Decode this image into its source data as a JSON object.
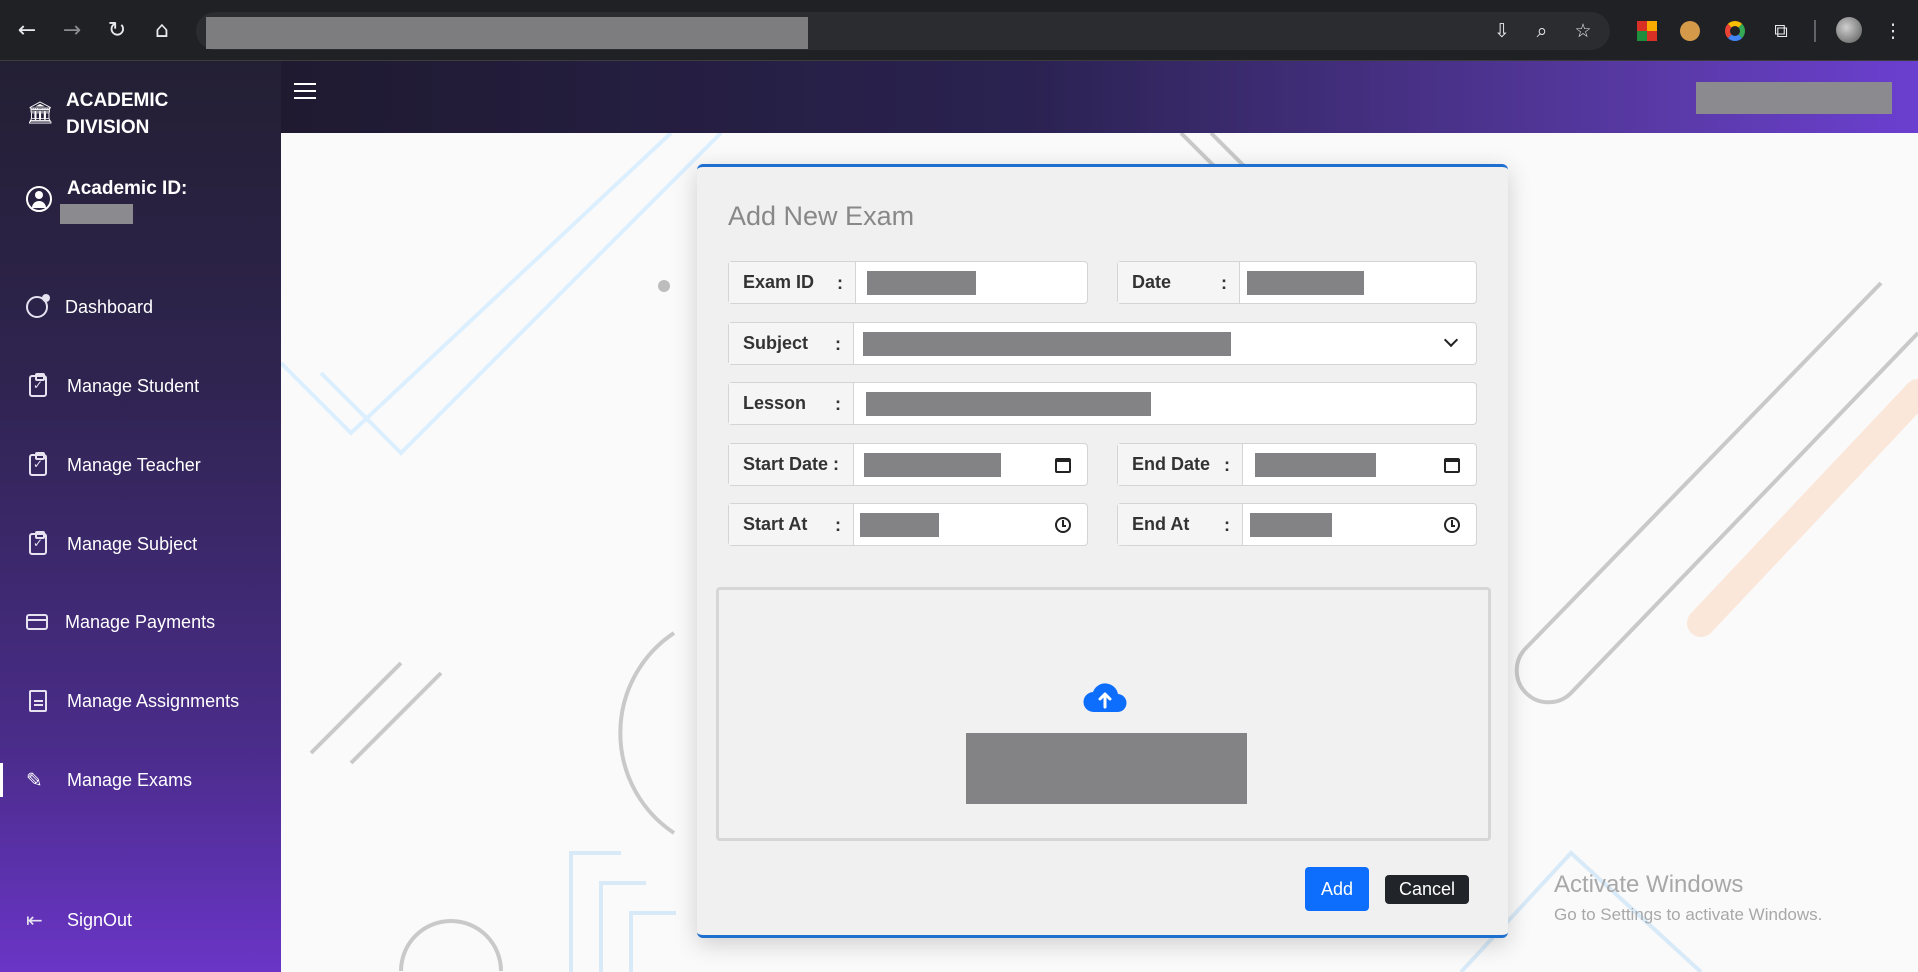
{
  "browser": {
    "icons": [
      "back-icon",
      "forward-icon",
      "reload-icon",
      "home-icon",
      "install-icon",
      "zoom-icon",
      "bookmark-star-icon",
      "extensions-icon",
      "profile-avatar",
      "more-menu-icon"
    ]
  },
  "sidebar": {
    "brand": "ACADEMIC DIVISION",
    "academic_id_label": "Academic ID:",
    "items": [
      {
        "label": "Dashboard",
        "icon": "dashboard-icon"
      },
      {
        "label": "Manage Student",
        "icon": "clipboard-check-icon"
      },
      {
        "label": "Manage Teacher",
        "icon": "clipboard-check-icon"
      },
      {
        "label": "Manage Subject",
        "icon": "clipboard-check-icon"
      },
      {
        "label": "Manage Payments",
        "icon": "credit-card-icon"
      },
      {
        "label": "Manage Assignments",
        "icon": "document-icon"
      },
      {
        "label": "Manage Exams",
        "icon": "edit-icon",
        "active": true
      }
    ],
    "signout": "SignOut"
  },
  "modal": {
    "title": "Add New Exam",
    "fields": {
      "exam_id": "Exam ID",
      "date": "Date",
      "subject": "Subject",
      "lesson": "Lesson",
      "start_date": "Start Date :",
      "end_date": "End Date",
      "start_at": "Start At",
      "end_at": "End At"
    },
    "colon": ":",
    "add_label": "Add",
    "cancel_label": "Cancel"
  },
  "watermark": {
    "line1": "Activate Windows",
    "line2": "Go to Settings to activate Windows."
  },
  "colors": {
    "accent": "#0d6efd",
    "modal_border": "#1f6fd0",
    "sidebar_top": "#231f33",
    "sidebar_bottom": "#6a35c6"
  }
}
